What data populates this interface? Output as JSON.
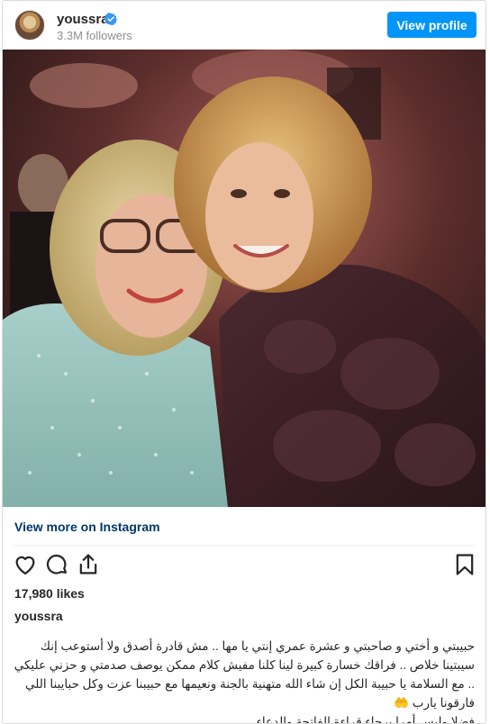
{
  "header": {
    "username": "youssra",
    "followers": "3.3M followers",
    "view_profile_label": "View profile"
  },
  "post": {
    "view_more_label": "View more on Instagram",
    "likes": "17,980 likes",
    "owner": "youssra",
    "caption": "حبيبتي و أختي و صاحبتي و عشرة عمري إنتي يا مها .. مش قادرة أصدق ولا أستوعب إنك سيبتينا خلاص .. فراقك خسارة كبيرة لينا كلنا مفيش كلام ممكن يوصف صدمتي و حزني عليكي .. مع السلامة يا حبيبة الكل إن شاء الله متهنية بالجنة ونعيمها مع حبيبنا عزت وكل حبايبنا اللي فارقونا يارب 🤲\nفضلا وليس أمرا برجاء قراءة الفاتحة والدعاء.\n#يسرا"
  },
  "icons": {
    "verified": "verified-badge-icon",
    "like": "heart-icon",
    "comment": "comment-bubble-icon",
    "share": "share-icon",
    "save": "bookmark-icon"
  },
  "colors": {
    "button_blue": "#0095f6",
    "link_dark_blue": "#00376b",
    "verified_blue": "#3897f0"
  }
}
